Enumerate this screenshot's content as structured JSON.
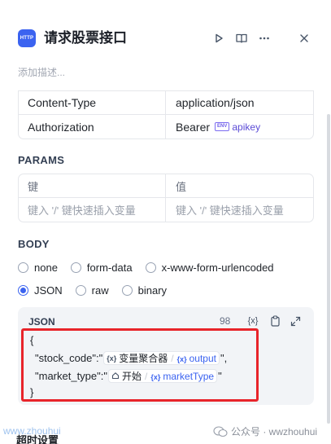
{
  "header": {
    "app_icon_text": "HTTP",
    "title": "请求股票接口",
    "description_placeholder": "添加描述...",
    "icons": [
      "play-icon",
      "book-open-icon",
      "more-icon",
      "close-icon"
    ]
  },
  "headers_table": {
    "rows": [
      {
        "key": "Content-Type",
        "value": "application/json"
      },
      {
        "key": "Authorization",
        "value": "Bearer",
        "env_badge": "ENV",
        "env_var": "apikey"
      }
    ]
  },
  "params": {
    "title": "PARAMS",
    "columns": [
      "键",
      "值"
    ],
    "placeholders": [
      "键入 '/' 键快速插入变量",
      "键入 '/' 键快速插入变量"
    ]
  },
  "body": {
    "title": "BODY",
    "options": [
      "none",
      "form-data",
      "x-www-form-urlencoded",
      "JSON",
      "raw",
      "binary"
    ],
    "selected": "JSON",
    "editor": {
      "label": "JSON",
      "count": "98",
      "var_button": "{x}",
      "open_brace": "{",
      "close_brace": "}",
      "line1_prefix": "\"stock_code\":\"",
      "line1_node": "变量聚合器",
      "line1_key": "output",
      "line1_suffix": "\",",
      "line2_prefix": "\"market_type\":\"",
      "line2_node": "开始",
      "line2_key": "marketType",
      "line2_suffix": "\""
    }
  },
  "footer": {
    "section_title": "超时设置",
    "watermark_left": "www.zhouhui",
    "watermark_right": "公众号 · wwzhouhui"
  },
  "colors": {
    "accent": "#3b63f0",
    "highlight_border": "#e8242a",
    "env": "#6d5ce8"
  }
}
